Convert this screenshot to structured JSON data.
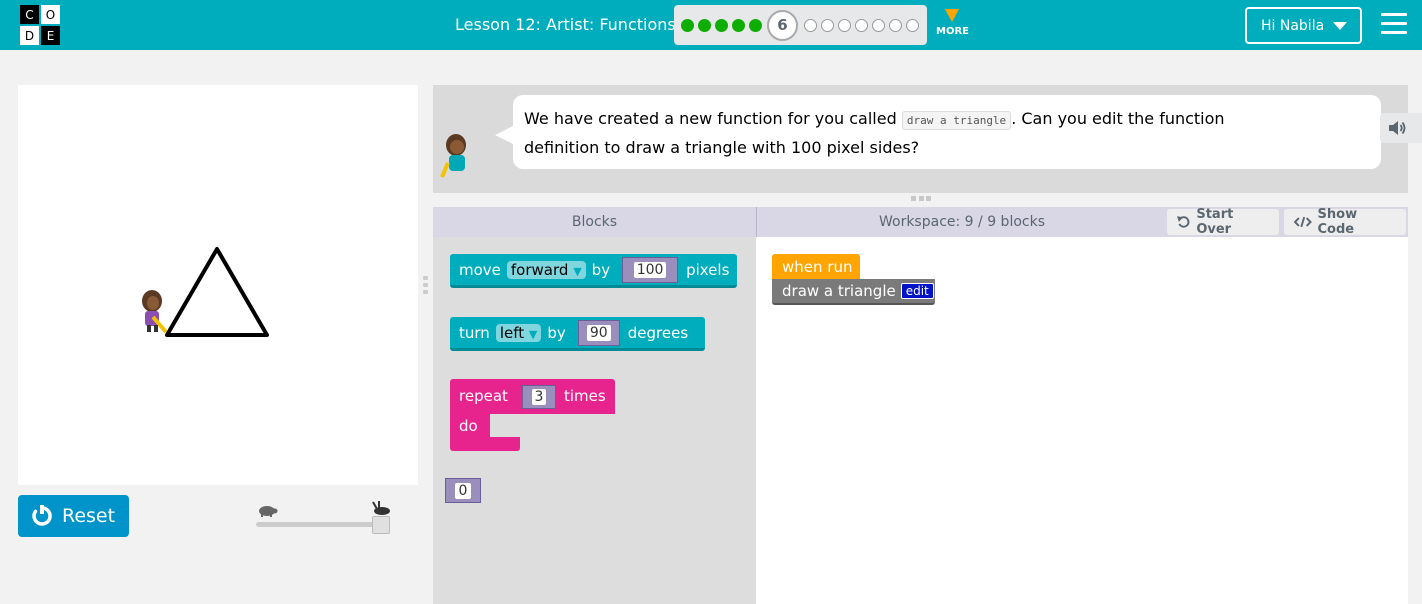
{
  "header": {
    "logo_letters": [
      "C",
      "O",
      "D",
      "E"
    ],
    "lesson_title": "Lesson 12: Artist: Functions",
    "current_puzzle": "6",
    "completed_dots": 5,
    "remaining_dots": 7,
    "more_label": "MORE",
    "user_greeting": "Hi Nabila"
  },
  "instructions": {
    "text_before": "We have created a new function for you called",
    "code": "draw a triangle",
    "text_after": ". Can you edit the function definition to draw a triangle with 100 pixel sides?"
  },
  "controls": {
    "reset_label": "Reset"
  },
  "workspace_header": {
    "blocks_label": "Blocks",
    "workspace_label": "Workspace: 9 / 9 blocks",
    "start_over_label": "Start Over",
    "show_code_label": "Show Code"
  },
  "toolbox": {
    "move_block": {
      "word1": "move",
      "dir": "forward",
      "word2": "by",
      "value": "100",
      "unit": "pixels"
    },
    "turn_block": {
      "word1": "turn",
      "dir": "left",
      "word2": "by",
      "value": "90",
      "unit": "degrees"
    },
    "repeat_block": {
      "word1": "repeat",
      "value": "3",
      "word2": "times",
      "do": "do"
    },
    "number_block": {
      "value": "0"
    }
  },
  "program": {
    "when_run_label": "when run",
    "function_call_label": "draw a triangle",
    "edit_label": "edit"
  },
  "colors": {
    "header": "#00adbc",
    "teal_block": "#00adbc",
    "pink_block": "#e7238d",
    "orange_block": "#ffa400",
    "gray_block": "#7a7a7a",
    "math_block": "#9a8fbc",
    "reset_button": "#0094ca"
  }
}
